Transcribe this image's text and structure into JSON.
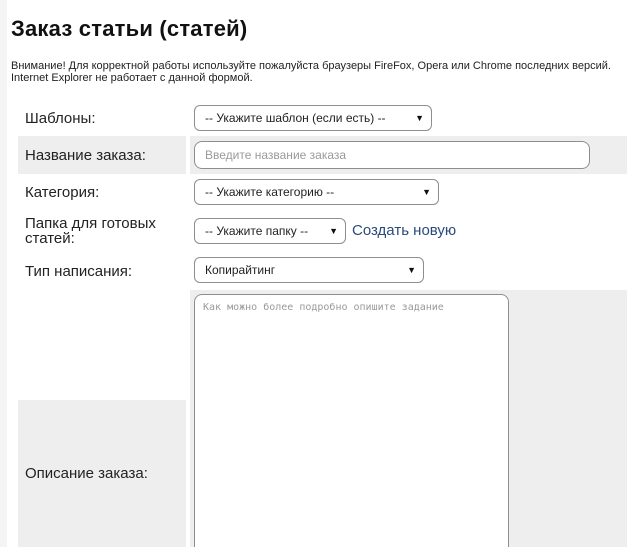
{
  "page": {
    "title": "Заказ статьи (статей)",
    "warning": "Внимание! Для корректной работы используйте пожалуйста браузеры FireFox, Opera или Chrome последних версий. Internet Explorer не работает с данной формой."
  },
  "form": {
    "template": {
      "label": "Шаблоны:",
      "selected": "-- Укажите шаблон (если есть) --"
    },
    "order_name": {
      "label": "Название заказа:",
      "value": "",
      "placeholder": "Введите название заказа"
    },
    "category": {
      "label": "Категория:",
      "selected": "-- Укажите категорию --"
    },
    "folder": {
      "label": "Папка для готовых статей:",
      "selected": "-- Укажите папку --",
      "create_link": "Создать новую"
    },
    "writing_type": {
      "label": "Тип написания:",
      "selected": "Копирайтинг"
    },
    "description": {
      "label": "Описание заказа:",
      "value": "",
      "placeholder": "Как можно более подробно опишите задание"
    }
  },
  "icons": {
    "dropdown": "chevron-down-icon"
  }
}
